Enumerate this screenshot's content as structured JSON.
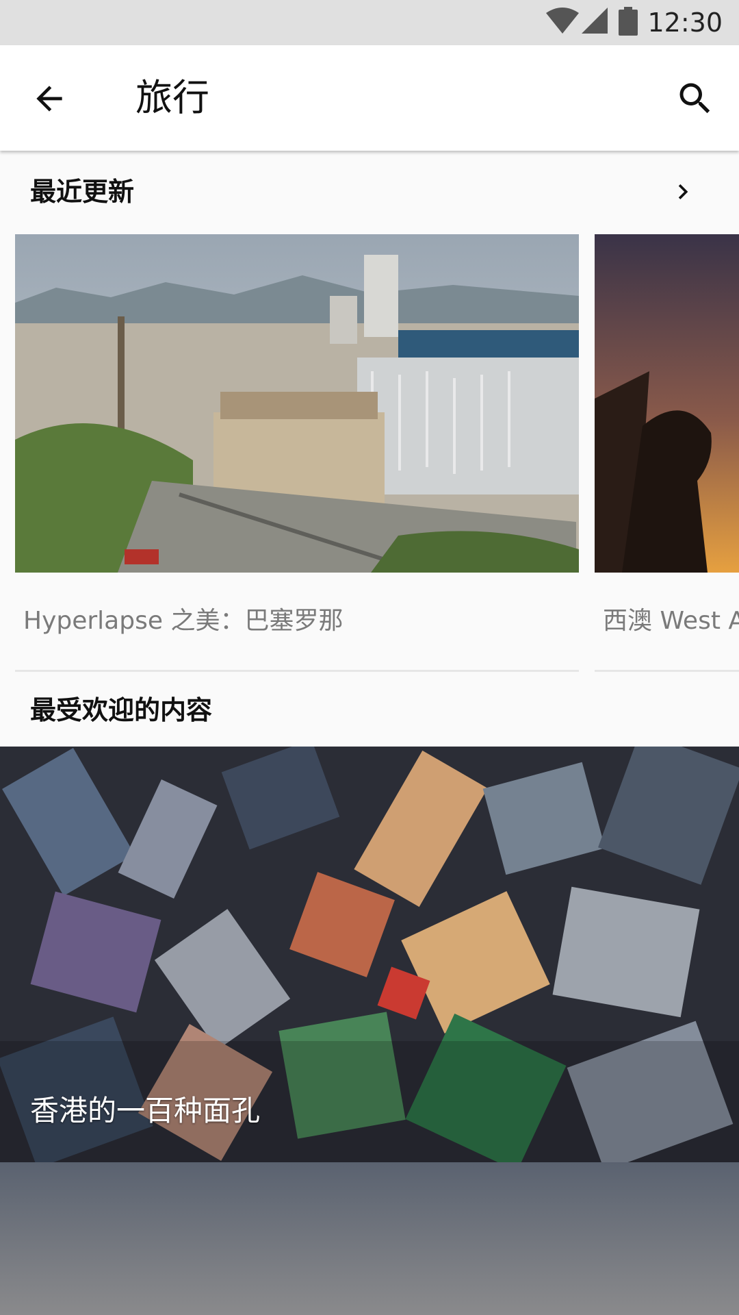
{
  "status_bar": {
    "time": "12:30",
    "icons": [
      "wifi-icon",
      "cell-signal-icon",
      "battery-icon"
    ]
  },
  "app_bar": {
    "title": "旅行",
    "back_icon": "arrow-back-icon",
    "search_icon": "search-icon"
  },
  "recent": {
    "title": "最近更新",
    "more_icon": "chevron-right-icon",
    "cards": [
      {
        "caption": "Hyperlapse 之美：巴塞罗那"
      },
      {
        "caption": "西澳 West A"
      }
    ]
  },
  "popular": {
    "title": "最受欢迎的内容",
    "items": [
      {
        "caption": "香港的一百种面孔"
      }
    ]
  },
  "colors": {
    "status_bar_bg": "#e0e0e0",
    "app_bar_bg": "#ffffff",
    "page_bg": "#fafafa",
    "caption_text": "#7a7a7a"
  }
}
